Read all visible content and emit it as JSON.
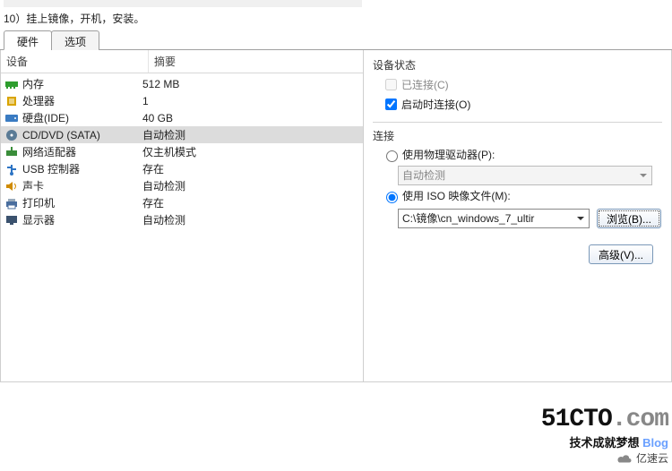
{
  "heading": "10）挂上镜像，开机，安装。",
  "tabs": {
    "hardware": "硬件",
    "options": "选项"
  },
  "columns": {
    "device": "设备",
    "summary": "摘要"
  },
  "devices": [
    {
      "icon": "memory",
      "name": "内存",
      "summary": "512 MB"
    },
    {
      "icon": "cpu",
      "name": "处理器",
      "summary": "1"
    },
    {
      "icon": "hdd",
      "name": "硬盘(IDE)",
      "summary": "40 GB"
    },
    {
      "icon": "cd",
      "name": "CD/DVD (SATA)",
      "summary": "自动检测",
      "selected": true
    },
    {
      "icon": "net",
      "name": "网络适配器",
      "summary": "仅主机模式"
    },
    {
      "icon": "usb",
      "name": "USB 控制器",
      "summary": "存在"
    },
    {
      "icon": "sound",
      "name": "声卡",
      "summary": "自动检测"
    },
    {
      "icon": "printer",
      "name": "打印机",
      "summary": "存在"
    },
    {
      "icon": "display",
      "name": "显示器",
      "summary": "自动检测"
    }
  ],
  "right": {
    "status_title": "设备状态",
    "connected_label": "已连接(C)",
    "connect_poweron_label": "启动时连接(O)",
    "connected_checked": false,
    "connect_poweron_checked": true,
    "connection_title": "连接",
    "physical_label": "使用物理驱动器(P):",
    "physical_selected": false,
    "autodetect": "自动检测",
    "iso_label": "使用 ISO 映像文件(M):",
    "iso_selected": true,
    "iso_path": "C:\\镜像\\cn_windows_7_ultir",
    "browse": "浏览(B)...",
    "advanced": "高级(V)..."
  },
  "watermark": {
    "main": "51CTO.com",
    "sub": "技术成就梦想",
    "blog": "Blog",
    "cloud": "亿速云"
  }
}
